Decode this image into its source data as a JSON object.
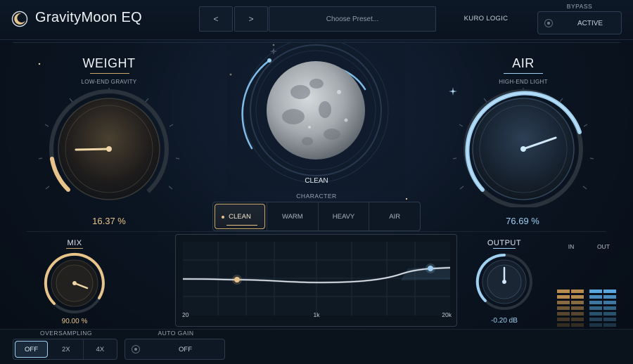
{
  "header": {
    "title": "GravityMoon EQ",
    "prev_label": "<",
    "next_label": ">",
    "preset_placeholder": "Choose Preset...",
    "brand": "KURO LOGIC",
    "bypass_label": "BYPASS",
    "bypass_state": "ACTIVE"
  },
  "weight": {
    "title": "WEIGHT",
    "subtitle": "LOW-END GRAVITY",
    "value": "16.37 %",
    "level": 0.1637
  },
  "air": {
    "title": "AIR",
    "subtitle": "HIGH-END LIGHT",
    "value": "76.69 %",
    "level": 0.7669
  },
  "moon": {
    "mode_label": "CLEAN"
  },
  "character": {
    "label": "CHARACTER",
    "options": [
      "CLEAN",
      "WARM",
      "HEAVY",
      "AIR"
    ],
    "selected": "CLEAN"
  },
  "mix": {
    "title": "MIX",
    "value": "90.00 %",
    "level": 0.9
  },
  "eq": {
    "x_ticks": [
      "20",
      "1k",
      "20k"
    ]
  },
  "output": {
    "title": "OUTPUT",
    "value": "-0.20 dB"
  },
  "meters": {
    "in_label": "IN",
    "out_label": "OUT"
  },
  "oversampling": {
    "label": "OVERSAMPLING",
    "options": [
      "OFF",
      "2X",
      "4X"
    ],
    "selected": "OFF"
  },
  "auto_gain": {
    "label": "AUTO GAIN",
    "state": "OFF"
  },
  "colors": {
    "gold": "#e8c48a",
    "blue": "#9fd0f2",
    "bg": "#0b1522"
  }
}
